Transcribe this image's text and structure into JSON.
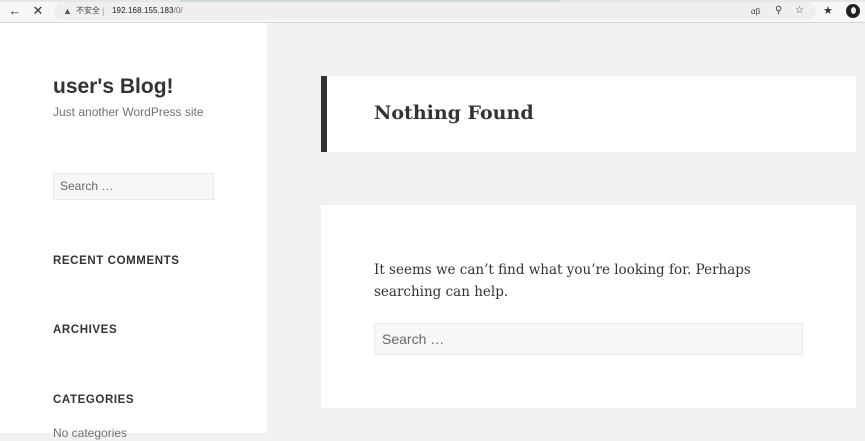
{
  "browser": {
    "security_label": "不安全",
    "separator": "|",
    "url_host": "192.168.155.183",
    "url_path": "/0/",
    "icons": {
      "back": "back-arrow-icon",
      "stop": "close-icon",
      "warning": "warning-icon",
      "translate": "translate-icon",
      "zoom": "zoom-icon",
      "bookmark": "star-icon",
      "extensions": "extensions-icon",
      "profile": "profile-avatar-icon"
    }
  },
  "sidebar": {
    "site_title": "user's Blog!",
    "site_description": "Just another WordPress site",
    "search_placeholder": "Search …",
    "widgets": {
      "recent_comments": "RECENT COMMENTS",
      "archives": "ARCHIVES",
      "categories": "CATEGORIES",
      "categories_empty": "No categories"
    }
  },
  "main": {
    "page_title": "Nothing Found",
    "message": "It seems we can’t find what you’re looking for. Perhaps searching can help.",
    "search_placeholder": "Search …"
  },
  "colors": {
    "sidebar_bg": "#ffffff",
    "page_bg": "#f1f1f1",
    "title_accent": "#333333",
    "text": "#333333",
    "muted_text": "#707070"
  }
}
